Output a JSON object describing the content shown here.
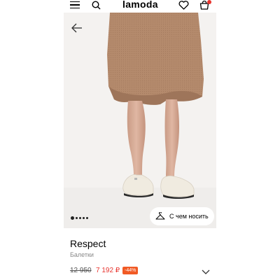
{
  "header": {
    "logo": "lamoda",
    "icons": [
      "menu-icon",
      "search-icon",
      "heart-icon",
      "bag-icon"
    ]
  },
  "gallery": {
    "slides_count": 5,
    "active_slide": 1,
    "try_on_label": "С чем носить"
  },
  "product": {
    "brand": "Respect",
    "category": "Балетки",
    "old_price": "12 950",
    "new_price": "7 192 ₽",
    "discount": "-44%"
  },
  "colors": {
    "accent": "#e8342e",
    "discount_bg": "#f15a24"
  }
}
